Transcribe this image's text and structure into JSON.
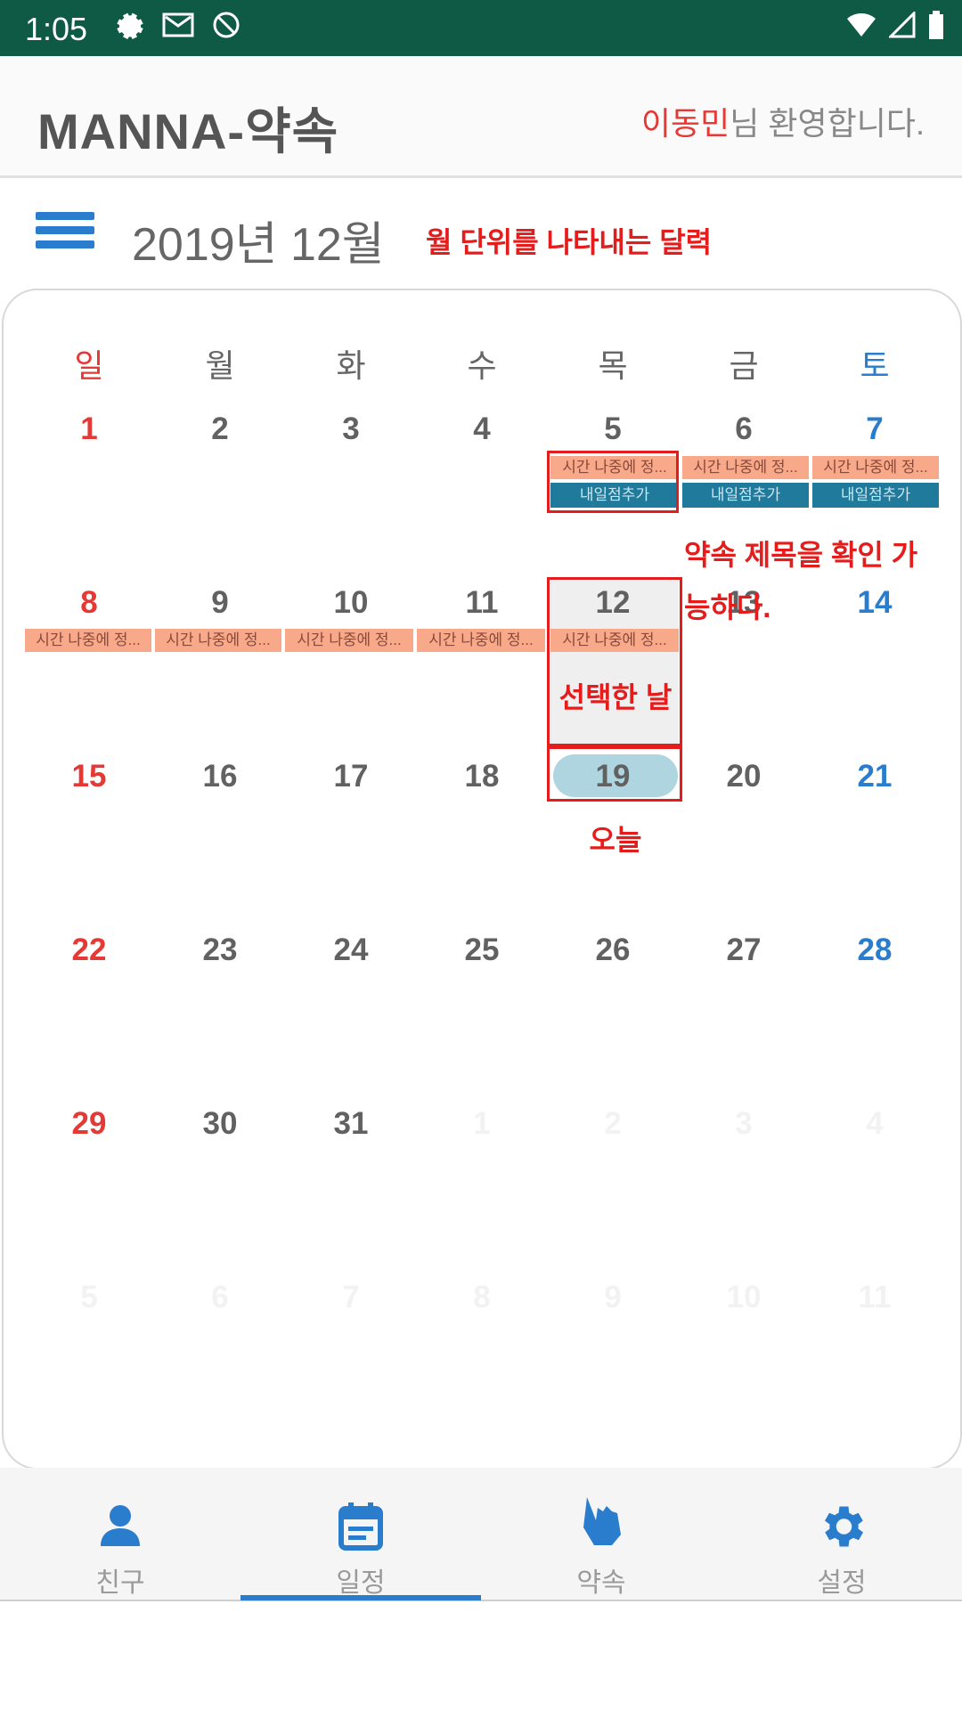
{
  "status_bar": {
    "time": "1:05"
  },
  "header": {
    "title": "MANNA-약속",
    "user_name": "이동민",
    "welcome_suffix": "님 환영합니다."
  },
  "calendar": {
    "month_label": "2019년 12월",
    "weekdays": [
      "일",
      "월",
      "화",
      "수",
      "목",
      "금",
      "토"
    ],
    "rows": [
      [
        "1",
        "2",
        "3",
        "4",
        "5",
        "6",
        "7"
      ],
      [
        "8",
        "9",
        "10",
        "11",
        "12",
        "13",
        "14"
      ],
      [
        "15",
        "16",
        "17",
        "18",
        "19",
        "20",
        "21"
      ],
      [
        "22",
        "23",
        "24",
        "25",
        "26",
        "27",
        "28"
      ],
      [
        "29",
        "30",
        "31",
        "1",
        "2",
        "3",
        "4"
      ],
      [
        "5",
        "6",
        "7",
        "8",
        "9",
        "10",
        "11"
      ]
    ],
    "event_title": "시간 나중에 정...",
    "event_title2": "내일점추가"
  },
  "annotations": {
    "monthly": "월 단위를 나타내는 달력",
    "title_check_1": "약속 제목을 확인 가",
    "title_check_2": "능하다.",
    "selected": "선택한 날",
    "today": "오늘"
  },
  "nav": {
    "items": [
      {
        "label": "친구",
        "icon": "person-icon"
      },
      {
        "label": "일정",
        "icon": "calendar-icon"
      },
      {
        "label": "약속",
        "icon": "hand-pointer-icon"
      },
      {
        "label": "설정",
        "icon": "gear-icon"
      }
    ],
    "active_index": 1
  },
  "colors": {
    "accent": "#2a7ccc",
    "sunday": "#e53935",
    "status_bar": "#0e5a45",
    "event": "#f7a98a",
    "event_dark": "#1f7a9c",
    "today": "#aed5e0",
    "annotation": "#e51c1c"
  }
}
